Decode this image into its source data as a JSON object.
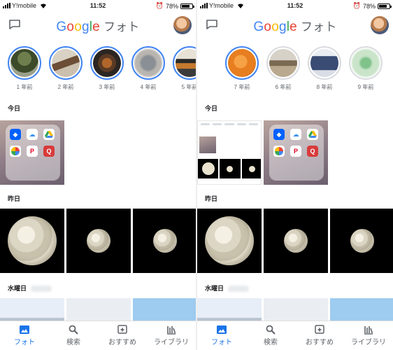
{
  "status_bar": {
    "carrier": "Y!mobile",
    "time": "11:52",
    "battery": "78%",
    "battery_level": 0.78
  },
  "header": {
    "logo_letters": [
      "G",
      "o",
      "o",
      "g",
      "l",
      "e"
    ],
    "logo_suffix": "フォト"
  },
  "left": {
    "memories": [
      {
        "label": "1 年前",
        "thumb": "tree",
        "ring": "blue"
      },
      {
        "label": "2 年前",
        "thumb": "cafe",
        "ring": "blue"
      },
      {
        "label": "3 年前",
        "thumb": "bowl",
        "ring": "blue"
      },
      {
        "label": "4 年前",
        "thumb": "blur",
        "ring": "blue"
      },
      {
        "label": "5 年前",
        "thumb": "food",
        "ring": "blue"
      }
    ],
    "sections": {
      "today": "今日",
      "yesterday": "昨日",
      "wednesday": "水曜日"
    }
  },
  "right": {
    "memories": [
      {
        "label": "7 年前",
        "thumb": "orange",
        "ring": "blue"
      },
      {
        "label": "6 年前",
        "thumb": "shop",
        "ring": "grey"
      },
      {
        "label": "8 年前",
        "thumb": "building",
        "ring": "grey"
      },
      {
        "label": "9 年前",
        "thumb": "green",
        "ring": "grey"
      }
    ],
    "sections": {
      "today": "今日",
      "yesterday": "昨日",
      "wednesday": "水曜日"
    }
  },
  "folder_apps": [
    "Dropbox",
    "iCloud",
    "Drive",
    "Photos",
    "Pinterest",
    "Q"
  ],
  "bottom_nav": [
    {
      "label": "フォト",
      "icon": "photo-icon",
      "active": true
    },
    {
      "label": "検索",
      "icon": "search-icon",
      "active": false
    },
    {
      "label": "おすすめ",
      "icon": "assistant-icon",
      "active": false
    },
    {
      "label": "ライブラリ",
      "icon": "library-icon",
      "active": false
    }
  ],
  "colors": {
    "accent": "#1a73e8",
    "ring_blue": "#4285F4",
    "ring_grey": "#dadce0"
  }
}
